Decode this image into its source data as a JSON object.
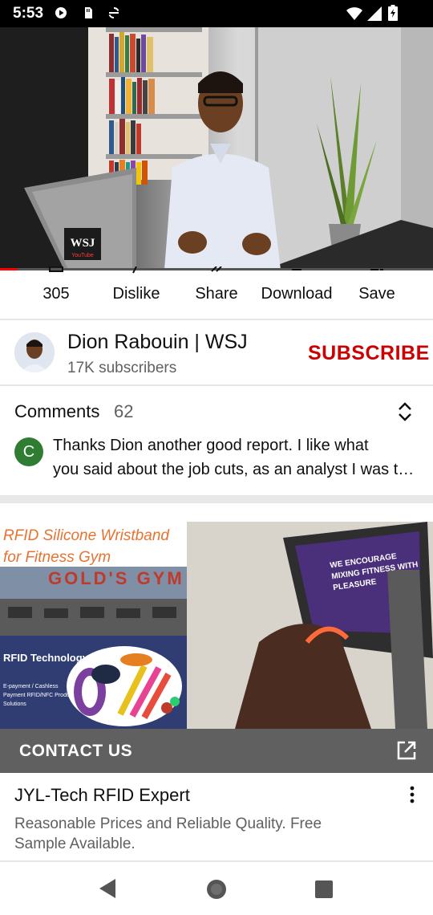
{
  "status_bar": {
    "time": "5:53",
    "icons": [
      "youtube-play-icon",
      "sim-card-icon",
      "sync-disabled-icon",
      "wifi-icon",
      "signal-icon",
      "battery-icon"
    ]
  },
  "video": {
    "watermark": "WSJ",
    "sub_watermark": "YouTube",
    "progress": 0.04
  },
  "actions": [
    {
      "icon": "like-icon",
      "label": "305"
    },
    {
      "icon": "dislike-icon",
      "label": "Dislike"
    },
    {
      "icon": "share-icon",
      "label": "Share"
    },
    {
      "icon": "download-icon",
      "label": "Download"
    },
    {
      "icon": "save-icon",
      "label": "Save"
    }
  ],
  "channel": {
    "name": "Dion Rabouin | WSJ",
    "subscribers": "17K subscribers",
    "subscribe_label": "SUBSCRIBE"
  },
  "comments": {
    "title": "Comments",
    "count": "62",
    "top_comment": {
      "avatar_letter": "C",
      "line1": "Thanks Dion another good report. I like what",
      "line2": "you said about the job cuts, as an analyst I was th..."
    }
  },
  "ad": {
    "headline": "RFID Silicone Wristband for Fitness Gym Management",
    "gym_sign": "GOLD'S GYM",
    "tech_label": "RFID Technology",
    "small_text": "E-payment / Cashless Payment RFID/NFC Product Solutions",
    "screen_text": "WE ENCOURAGE MIXING FITNESS WITH PLEASURE",
    "cta": "CONTACT US",
    "title": "JYL-Tech RFID Expert",
    "description": "Reasonable Prices and Reliable Quality. Free Sample Available."
  },
  "colors": {
    "subscribe": "#cc0000",
    "progress": "#ff0000",
    "comment_avatar": "#2e7d32",
    "cta_bar": "#606060"
  },
  "nav": [
    "back-icon",
    "home-icon",
    "recents-icon"
  ]
}
